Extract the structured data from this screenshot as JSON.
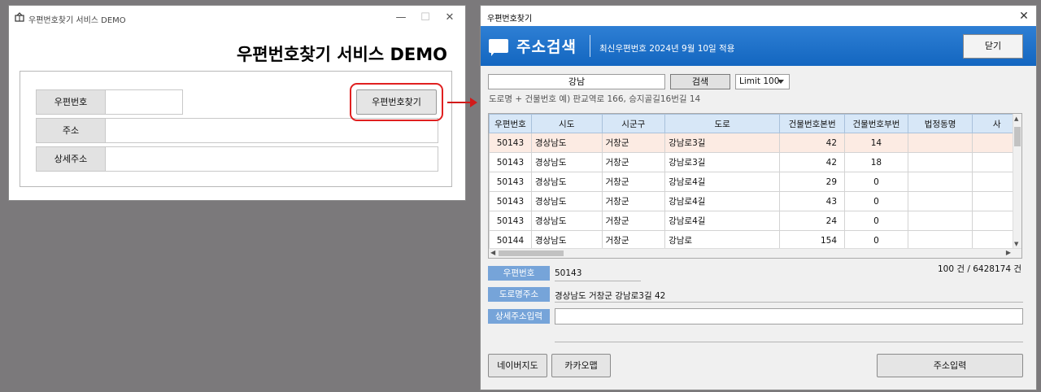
{
  "left_window": {
    "title": "우편번호찾기 서비스 DEMO",
    "heading": "우편번호찾기 서비스 DEMO",
    "rows": [
      {
        "label": "우편번호"
      },
      {
        "label": "주소"
      },
      {
        "label": "상세주소"
      }
    ],
    "find_button": "우편번호찾기"
  },
  "right_window": {
    "title": "우편번호찾기",
    "header_title": "주소검색",
    "header_sub": "최신우편번호 2024년 9월 10일 적용",
    "close_label": "닫기",
    "search": {
      "value": "강남",
      "button": "검색",
      "limit": "Limit 100"
    },
    "hint": "도로명 + 건물번호 예) 판교역로 166, 승지골길16번길 14",
    "grid": {
      "columns": [
        "우편번호",
        "시도",
        "시군구",
        "도로",
        "건물번호본번",
        "건물번호부번",
        "법정동명",
        "사"
      ],
      "rows": [
        [
          "50143",
          "경상남도",
          "거창군",
          "강남로3길",
          "42",
          "14",
          ""
        ],
        [
          "50143",
          "경상남도",
          "거창군",
          "강남로3길",
          "42",
          "18",
          ""
        ],
        [
          "50143",
          "경상남도",
          "거창군",
          "강남로4길",
          "29",
          "0",
          ""
        ],
        [
          "50143",
          "경상남도",
          "거창군",
          "강남로4길",
          "43",
          "0",
          ""
        ],
        [
          "50143",
          "경상남도",
          "거창군",
          "강남로4길",
          "24",
          "0",
          ""
        ],
        [
          "50144",
          "경상남도",
          "거창군",
          "강남로",
          "154",
          "0",
          ""
        ]
      ],
      "selected_row": 0
    },
    "fields": {
      "zip_label": "우편번호",
      "zip_value": "50143",
      "road_label": "도로명주소",
      "road_value": "경상남도 거창군 강남로3길 42",
      "detail_label": "상세주소입력"
    },
    "count": "100 건 / 6428174 건",
    "buttons": {
      "naver": "네이버지도",
      "kakao": "카카오맵",
      "submit": "주소입력"
    }
  },
  "colors": {
    "accent": "#1e72c8",
    "highlight": "#e02020",
    "field_label": "#76a4d9",
    "selected_row": "#fcebe3"
  }
}
